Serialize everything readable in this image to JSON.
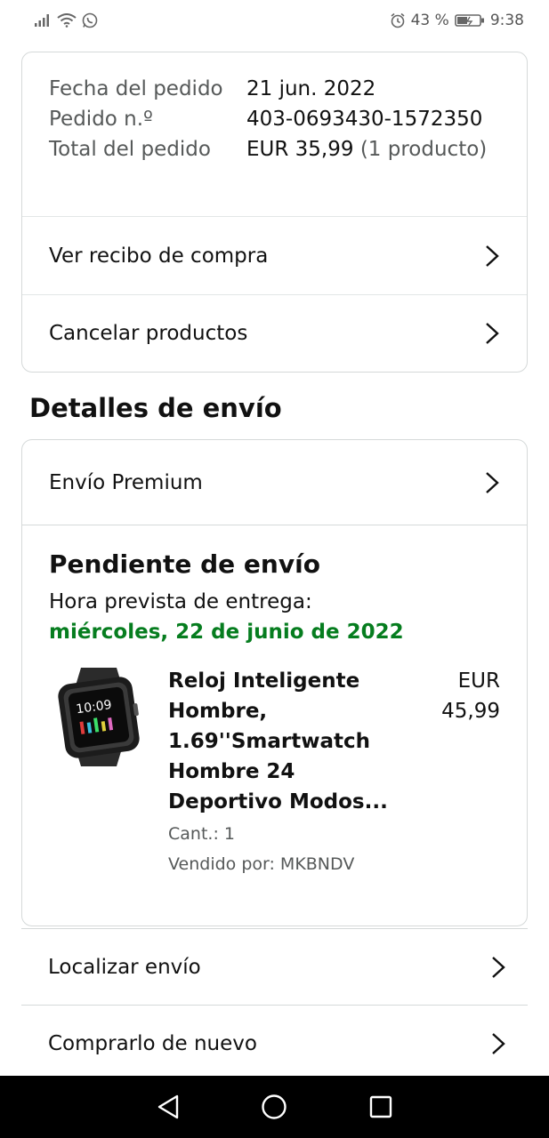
{
  "status_bar": {
    "battery_percent": "43 %",
    "time": "9:38"
  },
  "order_summary": {
    "date_label": "Fecha del pedido",
    "date_value": "21 jun. 2022",
    "number_label": "Pedido n.º",
    "number_value": "403-0693430-1572350",
    "total_label": "Total del pedido",
    "total_value": "EUR 35,99",
    "total_qty": "(1 producto)"
  },
  "actions": {
    "receipt": "Ver recibo de compra",
    "cancel": "Cancelar productos"
  },
  "shipping": {
    "section_title": "Detalles de envío",
    "method": "Envío Premium",
    "status_title": "Pendiente de envío",
    "eta_label": "Hora prevista de entrega:",
    "eta_date": "miércoles, 22 de junio de 2022"
  },
  "product": {
    "title_lines": [
      "Reloj Inteligente",
      "Hombre,",
      "1.69''Smartwatch",
      "Hombre 24",
      "Deportivo Modos..."
    ],
    "qty": "Cant.: 1",
    "seller": "Vendido por: MKBNDV",
    "price_currency": "EUR",
    "price_value": "45,99",
    "watch_time": "10:09"
  },
  "footer_actions": {
    "track": "Localizar envío",
    "buy_again": "Comprarlo de nuevo"
  },
  "colors": {
    "eta_green": "#067d1f",
    "border": "#d5d9d9",
    "muted_text": "#565959"
  }
}
